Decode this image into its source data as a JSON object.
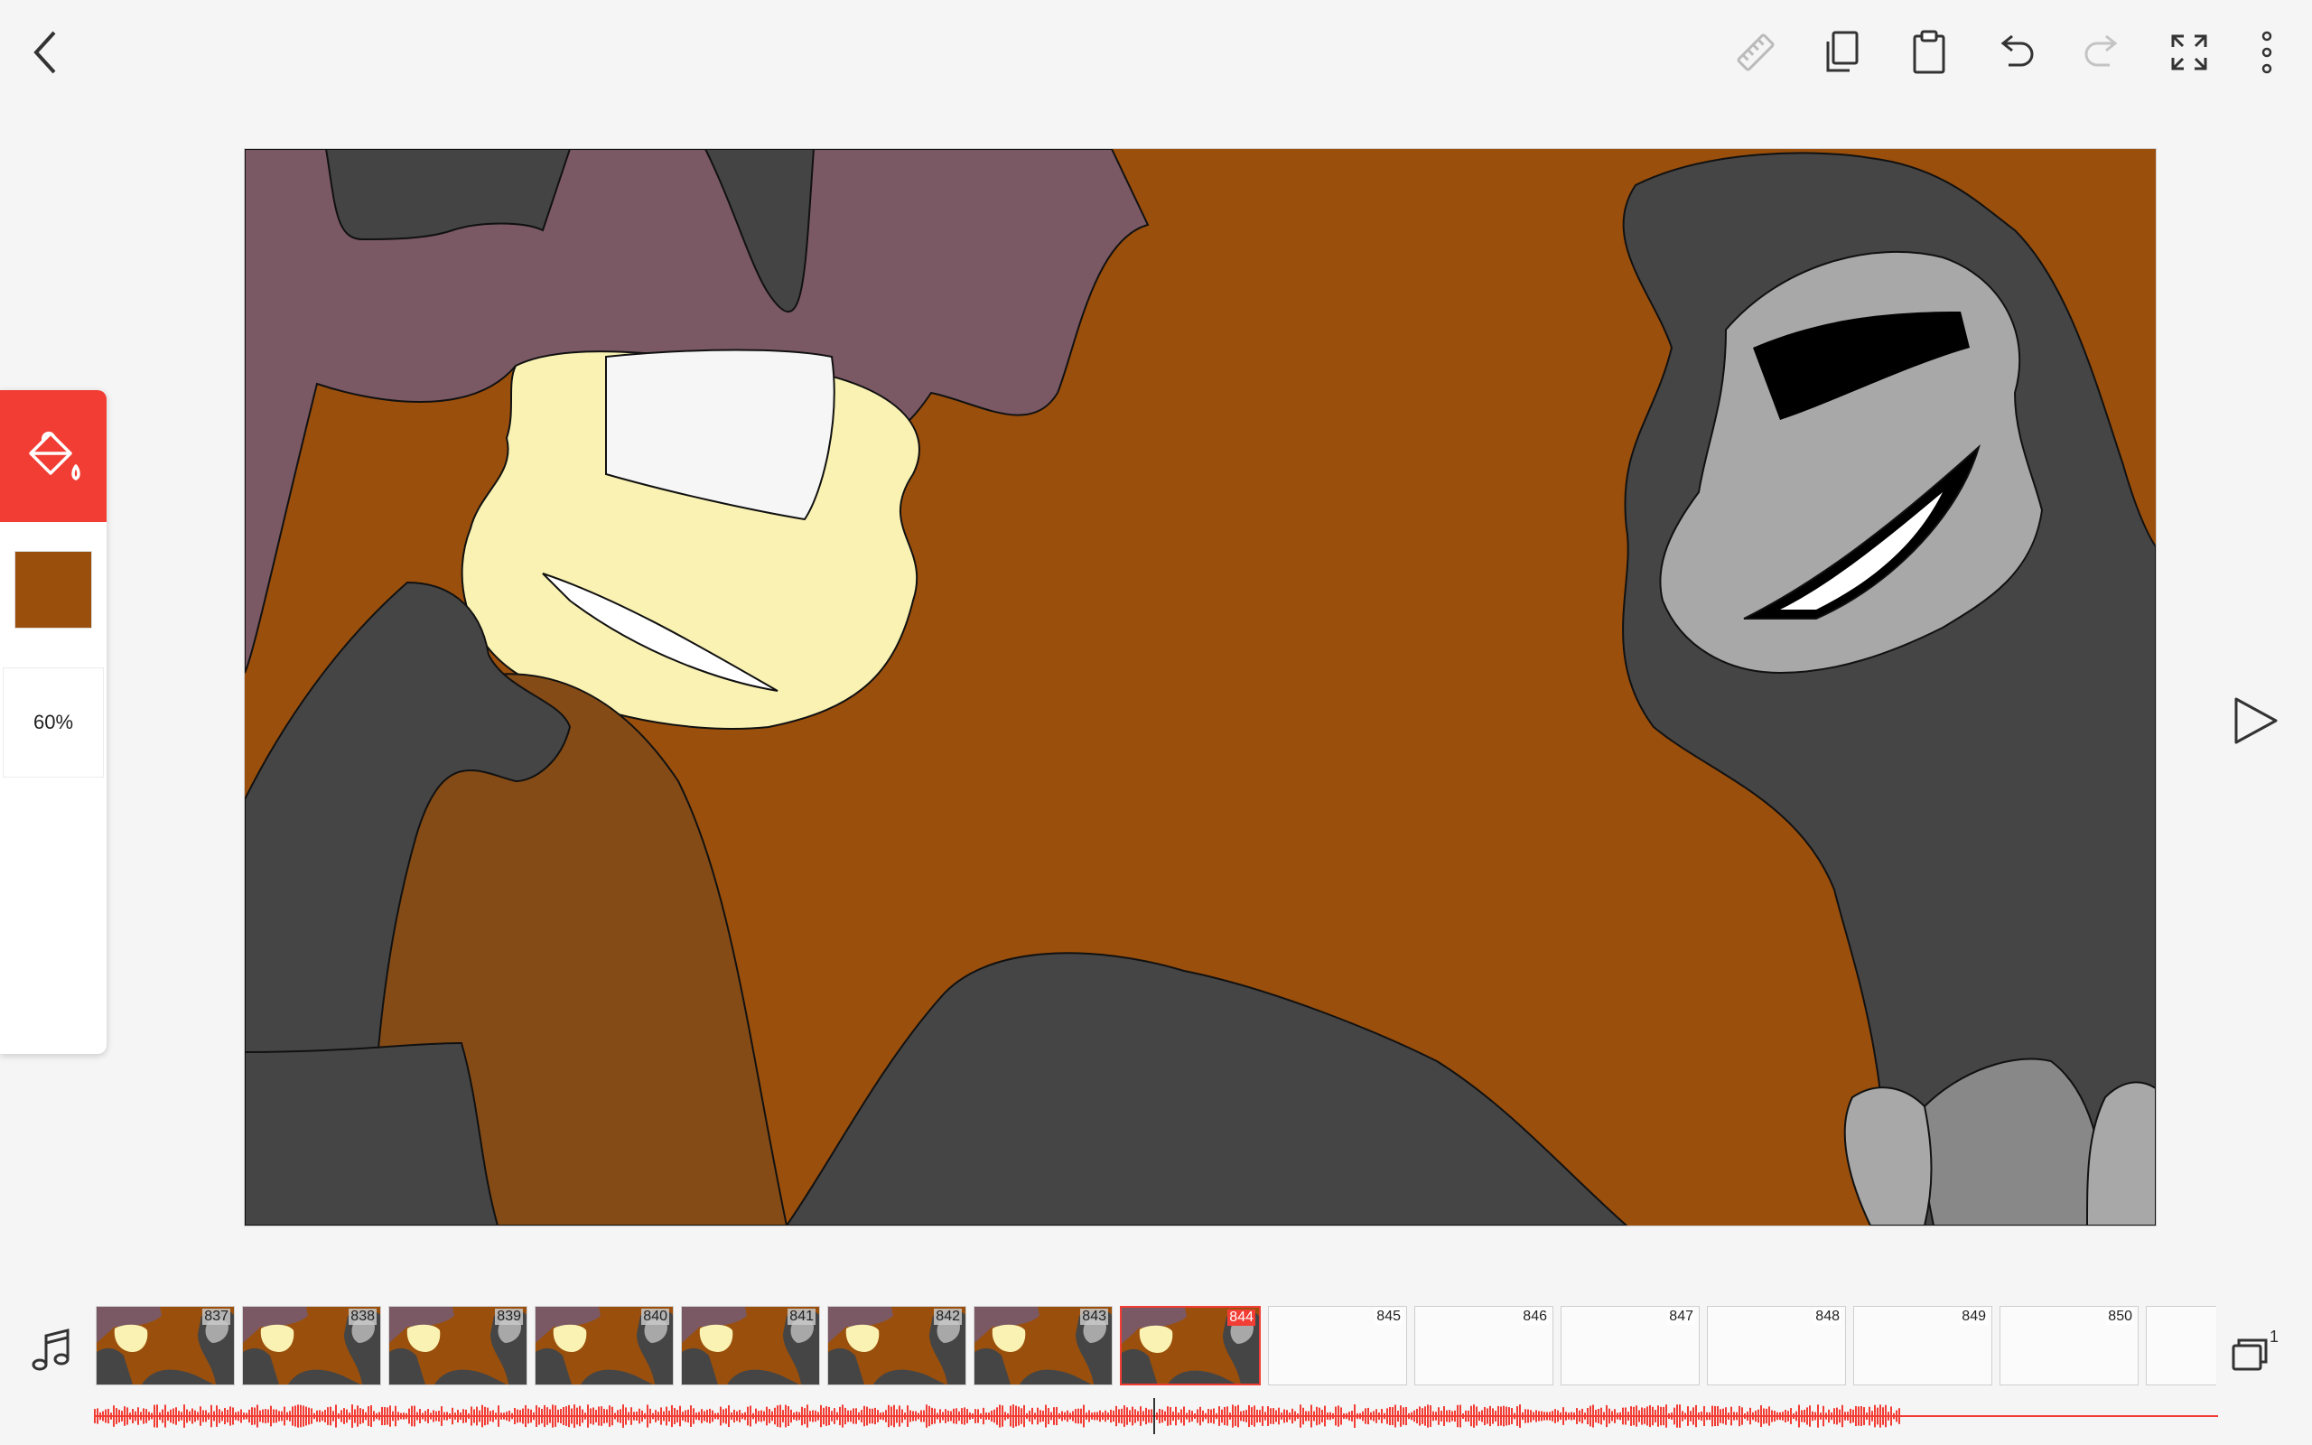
{
  "toolbar": {
    "icons": [
      "back-icon",
      "ruler-icon",
      "copy-icon",
      "paste-icon",
      "undo-icon",
      "redo-icon",
      "fullscreen-icon",
      "more-icon"
    ]
  },
  "tool_panel": {
    "active_tool": "paint-bucket-icon",
    "accent": "#f23d35",
    "color": "#9a4f0c",
    "opacity_label": "60%"
  },
  "timeline": {
    "frames": [
      {
        "num": "837",
        "filled": true
      },
      {
        "num": "838",
        "filled": true
      },
      {
        "num": "839",
        "filled": true
      },
      {
        "num": "840",
        "filled": true
      },
      {
        "num": "841",
        "filled": true
      },
      {
        "num": "842",
        "filled": true
      },
      {
        "num": "843",
        "filled": true
      },
      {
        "num": "844",
        "filled": true,
        "current": true
      },
      {
        "num": "845",
        "filled": false
      },
      {
        "num": "846",
        "filled": false
      },
      {
        "num": "847",
        "filled": false
      },
      {
        "num": "848",
        "filled": false
      },
      {
        "num": "849",
        "filled": false
      },
      {
        "num": "850",
        "filled": false
      },
      {
        "num": "",
        "filled": false
      }
    ],
    "layers_count": "1"
  }
}
